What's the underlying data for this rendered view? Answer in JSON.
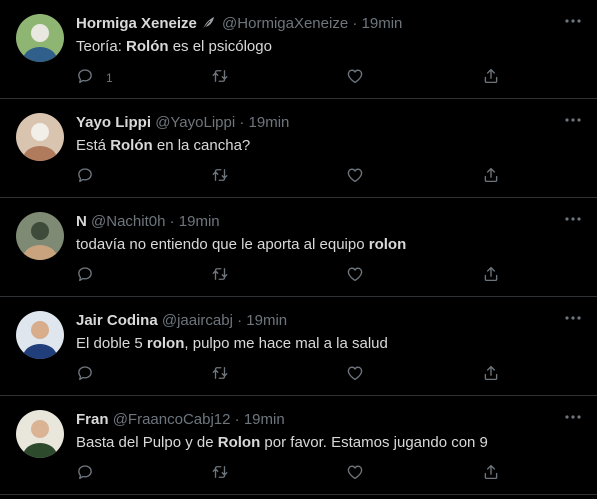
{
  "tweets": [
    {
      "name": "Hormiga Xeneize",
      "handle": "@HormigaXeneize",
      "separator": "·",
      "time": "19min",
      "has_badge": true,
      "text_parts": [
        "Teoría: ",
        "Rolón",
        " es el psicólogo"
      ],
      "reply_count": "1",
      "avatar_colors": [
        "#8fb573",
        "#2f5f8a",
        "#e8e8e0"
      ]
    },
    {
      "name": "Yayo Lippi",
      "handle": "@YayoLippi",
      "separator": "·",
      "time": "19min",
      "has_badge": false,
      "text_parts": [
        "Está ",
        "Rolón",
        " en la cancha?"
      ],
      "reply_count": "",
      "avatar_colors": [
        "#d9c4b0",
        "#b07a5c",
        "#f2eee8"
      ]
    },
    {
      "name": "N",
      "handle": "@Nachit0h",
      "separator": "·",
      "time": "19min",
      "has_badge": false,
      "text_parts": [
        "todavía no entiendo que le aporta al equipo ",
        "rolon",
        ""
      ],
      "reply_count": "",
      "avatar_colors": [
        "#7f8a74",
        "#c9a27e",
        "#3e4a3a"
      ]
    },
    {
      "name": "Jair Codina",
      "handle": "@jaaircabj",
      "separator": "·",
      "time": "19min",
      "has_badge": false,
      "text_parts": [
        "El doble 5 ",
        "rolon",
        ", pulpo me hace mal a la salud"
      ],
      "reply_count": "",
      "avatar_colors": [
        "#dfe6ee",
        "#1f3e7a",
        "#d8ad8c"
      ]
    },
    {
      "name": "Fran",
      "handle": "@FraancoCabj12",
      "separator": "·",
      "time": "19min",
      "has_badge": false,
      "text_parts": [
        "Basta del Pulpo y de ",
        "Rolon",
        " por favor. Estamos jugando con 9"
      ],
      "reply_count": "",
      "avatar_colors": [
        "#e9e6dc",
        "#2e4a2c",
        "#d9b394"
      ]
    }
  ],
  "icons": {
    "more": "more-icon",
    "reply": "reply-icon",
    "retweet": "retweet-icon",
    "like": "like-icon",
    "share": "share-icon",
    "badge": "feather-badge-icon"
  },
  "colors": {
    "background": "#000000",
    "text": "#d9d9d9",
    "secondary": "#6e767d",
    "divider": "#2f3336"
  }
}
